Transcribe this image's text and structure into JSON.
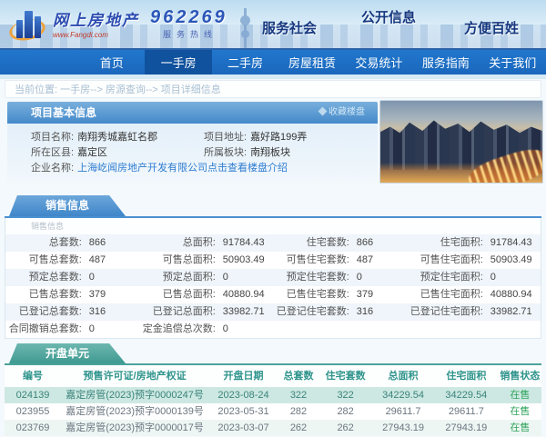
{
  "banner": {
    "logo_title": "网上房地产",
    "logo_sub": "www.Fangdi.com",
    "hotline_number": "962269",
    "hotline_label": "服务热线",
    "slogans": [
      "服务社会",
      "公开信息",
      "方便百姓"
    ]
  },
  "nav": {
    "items": [
      "首页",
      "一手房",
      "二手房",
      "房屋租赁",
      "交易统计",
      "服务指南",
      "关于我们"
    ],
    "active": "一手房"
  },
  "breadcrumb": "当前位置: 一手房--> 房源查询--> 项目详细信息",
  "project": {
    "section_title": "项目基本信息",
    "favorite_link": "收藏楼盘",
    "name_label": "项目名称:",
    "name_value": "南翔秀城嘉虹名郡",
    "addr_label": "项目地址:",
    "addr_value": "嘉好路199弄",
    "district_label": "所在区县:",
    "district_value": "嘉定区",
    "block_label": "所属板块:",
    "block_value": "南翔板块",
    "company_label": "企业名称:",
    "company_value": "上海屹闻房地产开发有限公司",
    "intro_link": "点击查看楼盘介绍"
  },
  "sales": {
    "tab_title": "销售信息",
    "watermark": "销售信息",
    "rows": [
      [
        {
          "label": "总套数:",
          "value": "866"
        },
        {
          "label": "总面积:",
          "value": "91784.43"
        },
        {
          "label": "住宅套数:",
          "value": "866"
        },
        {
          "label": "住宅面积:",
          "value": "91784.43"
        }
      ],
      [
        {
          "label": "可售总套数:",
          "value": "487"
        },
        {
          "label": "可售总面积:",
          "value": "50903.49"
        },
        {
          "label": "可售住宅套数:",
          "value": "487"
        },
        {
          "label": "可售住宅面积:",
          "value": "50903.49"
        }
      ],
      [
        {
          "label": "预定总套数:",
          "value": "0"
        },
        {
          "label": "预定总面积:",
          "value": "0"
        },
        {
          "label": "预定住宅套数:",
          "value": "0"
        },
        {
          "label": "预定住宅面积:",
          "value": "0"
        }
      ],
      [
        {
          "label": "已售总套数:",
          "value": "379"
        },
        {
          "label": "已售总面积:",
          "value": "40880.94"
        },
        {
          "label": "已售住宅套数:",
          "value": "379"
        },
        {
          "label": "已售住宅面积:",
          "value": "40880.94"
        }
      ],
      [
        {
          "label": "已登记总套数:",
          "value": "316"
        },
        {
          "label": "已登记总面积:",
          "value": "33982.71"
        },
        {
          "label": "已登记住宅套数:",
          "value": "316"
        },
        {
          "label": "已登记住宅面积:",
          "value": "33982.71"
        }
      ],
      [
        {
          "label": "合同撤销总套数:",
          "value": "0"
        },
        {
          "label": "定金追偿总次数:",
          "value": "0"
        }
      ]
    ]
  },
  "units": {
    "tab_title": "开盘单元",
    "columns": [
      "编号",
      "预售许可证/房地产权证",
      "开盘日期",
      "总套数",
      "住宅套数",
      "总面积",
      "住宅面积",
      "销售状态"
    ],
    "rows": [
      [
        "024139",
        "嘉定房管(2023)预字0000247号",
        "2023-08-24",
        "322",
        "322",
        "34229.54",
        "34229.54",
        "在售"
      ],
      [
        "023955",
        "嘉定房管(2023)预字0000139号",
        "2023-05-31",
        "282",
        "282",
        "29611.7",
        "29611.7",
        "在售"
      ],
      [
        "023769",
        "嘉定房管(2023)预字0000017号",
        "2023-03-07",
        "262",
        "262",
        "27943.19",
        "27943.19",
        "在售"
      ]
    ]
  },
  "colors": {
    "nav_blue": "#1a67bd",
    "active_blue": "#10529e",
    "section_blue": "#4389ca",
    "section_teal": "#3f9a91",
    "status_green": "#2fa45c"
  }
}
